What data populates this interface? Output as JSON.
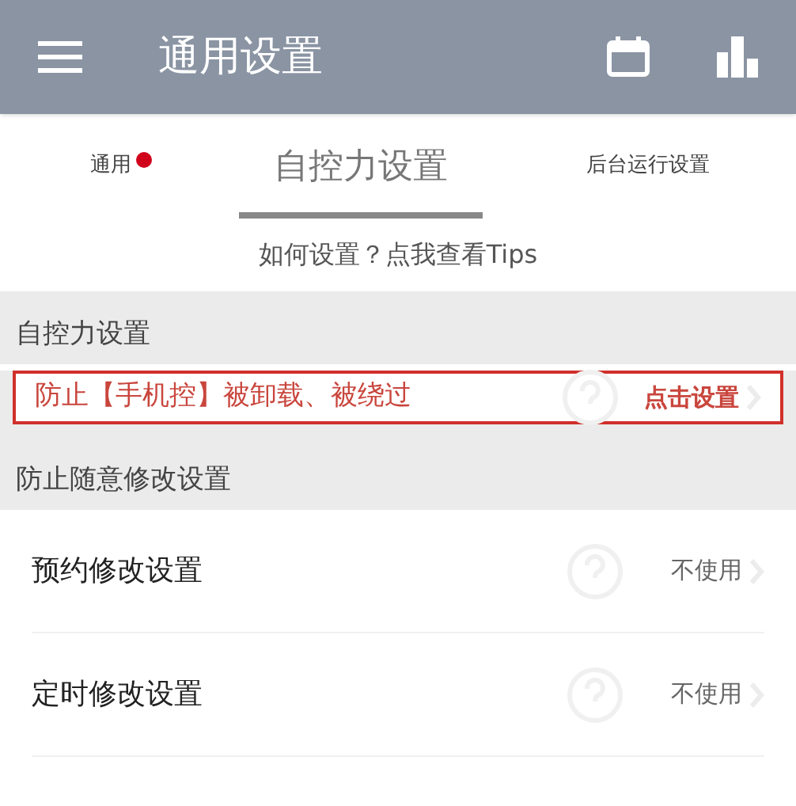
{
  "app_bar": {
    "title": "通用设置"
  },
  "tabs": [
    {
      "label": "通用",
      "selected": false,
      "badge": true
    },
    {
      "label": "自控力设置",
      "selected": true,
      "badge": false
    },
    {
      "label": "后台运行设置",
      "selected": false,
      "badge": false
    }
  ],
  "tips_link": "如何设置？点我查看Tips",
  "sections": [
    {
      "title": "自控力设置",
      "rows": [
        {
          "label": "防止【手机控】被卸载、被绕过",
          "value": "点击设置",
          "highlighted": true
        }
      ]
    },
    {
      "title": "防止随意修改设置",
      "rows": [
        {
          "label": "预约修改设置",
          "value": "不使用",
          "highlighted": false
        },
        {
          "label": "定时修改设置",
          "value": "不使用",
          "highlighted": false
        }
      ]
    }
  ]
}
